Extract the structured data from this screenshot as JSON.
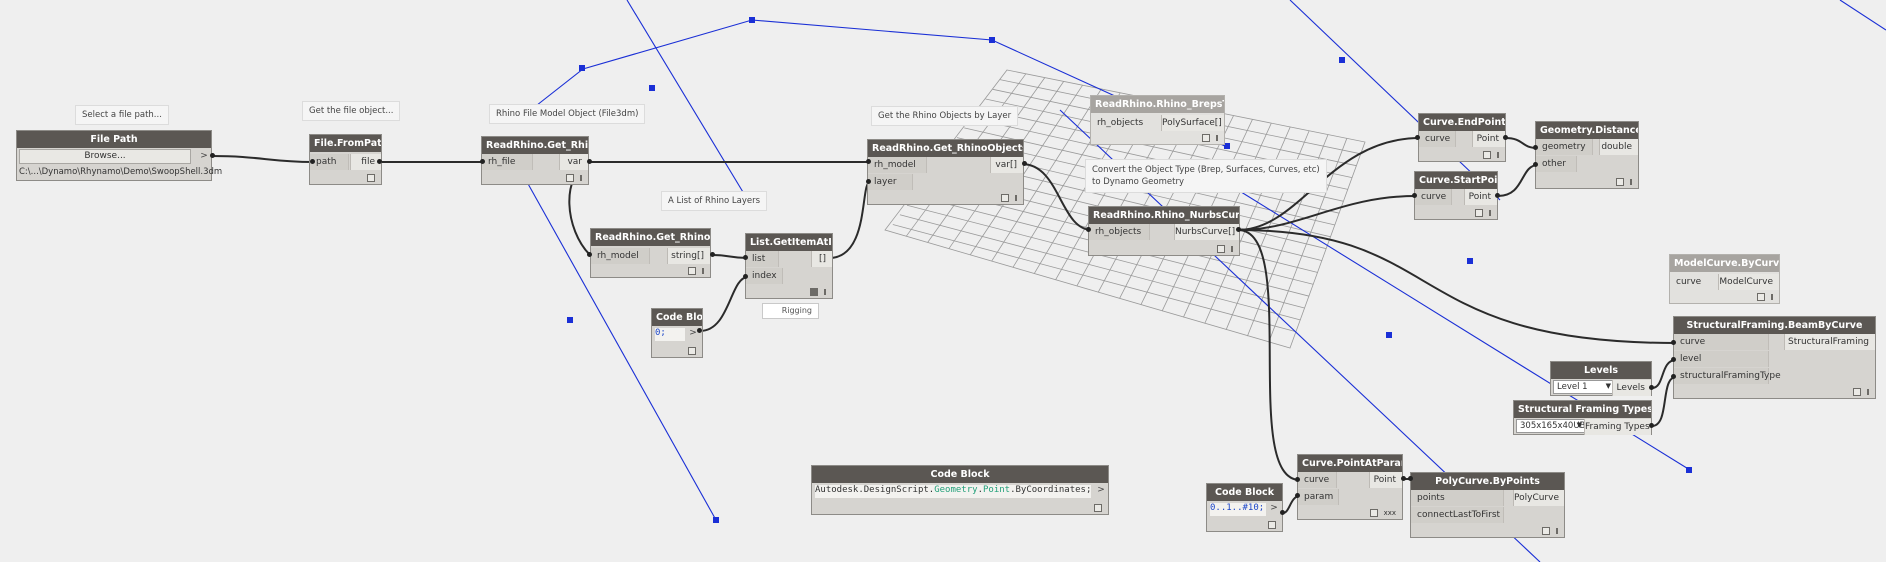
{
  "labels": {
    "select_file": "Select a file path...",
    "get_file_obj": "Get the file object...",
    "rhino_file_model": "Rhino File Model Object (File3dm)",
    "get_rhino_objects": "Get the Rhino Objects by Layer",
    "list_rhino_layers": "A List of Rhino Layers",
    "convert_type_line1": "Convert the Object Type (Brep, Surfaces, Curves, etc)",
    "convert_type_line2": "to Dynamo Geometry"
  },
  "nodes": {
    "file_path": {
      "title": "File Path",
      "browse": "Browse...",
      "arrow": ">",
      "value": "C:\\...\\Dynamo\\Rhynamo\\Demo\\SwoopShell.3dm"
    },
    "file_from_path": {
      "title": "File.FromPath",
      "in": "path",
      "out": "file"
    },
    "get_rhinofile": {
      "title": "ReadRhino.Get_RhinoFile",
      "in": "rh_file",
      "out": "var"
    },
    "get_rhinolayers": {
      "title": "ReadRhino.Get_RhinoLayers",
      "in": "rh_model",
      "out": "string[]"
    },
    "get_item_at_index": {
      "title": "List.GetItemAtIndex",
      "in1": "list",
      "in2": "index",
      "out": "[]",
      "watch": "Rigging"
    },
    "code_block_0": {
      "title": "Code Block",
      "code": "0;",
      "arrow": ">"
    },
    "get_objects_by_layer": {
      "title": "ReadRhino.Get_RhinoObjectsByLayer",
      "in1": "rh_model",
      "in2": "layer",
      "out": "var[]"
    },
    "breps_to_ds": {
      "title": "ReadRhino.Rhino_BrepsToDS",
      "in": "rh_objects",
      "out": "PolySurface[]"
    },
    "nurbs_to_ds": {
      "title": "ReadRhino.Rhino_NurbsCurvesToDS",
      "in": "rh_objects",
      "out": "NurbsCurve[]"
    },
    "curve_endpoint": {
      "title": "Curve.EndPoint",
      "in": "curve",
      "out": "Point"
    },
    "curve_startpoint": {
      "title": "Curve.StartPoint",
      "in": "curve",
      "out": "Point"
    },
    "distance_to": {
      "title": "Geometry.DistanceTo",
      "in1": "geometry",
      "in2": "other",
      "out": "double"
    },
    "model_curve": {
      "title": "ModelCurve.ByCurve",
      "in": "curve",
      "out": "ModelCurve"
    },
    "beam_by_curve": {
      "title": "StructuralFraming.BeamByCurve",
      "in1": "curve",
      "in2": "level",
      "in3": "structuralFramingType",
      "out": "StructuralFraming"
    },
    "levels": {
      "title": "Levels",
      "selected": "Level 1",
      "out": "Levels"
    },
    "framing_types": {
      "title": "Structural Framing Types",
      "selected": "305x165x40UB",
      "out": "Framing Types"
    },
    "code_block_point": {
      "title": "Code Block",
      "code_pre": "Autodesk.DesignScript.",
      "code_cls": "Geometry",
      "code_mid": ".",
      "code_cls2": "Point",
      "code_post": ".ByCoordinates;",
      "arrow": ">"
    },
    "point_at_param": {
      "title": "Curve.PointAtParameter",
      "in1": "curve",
      "in2": "param",
      "out": "Point",
      "lacing": "xxx"
    },
    "code_block_range": {
      "title": "Code Block",
      "code": "0..1..#10;",
      "arrow": ">"
    },
    "polycurve": {
      "title": "PolyCurve.ByPoints",
      "in1": "points",
      "in2": "connectLastToFirst",
      "out": "PolyCurve"
    }
  }
}
